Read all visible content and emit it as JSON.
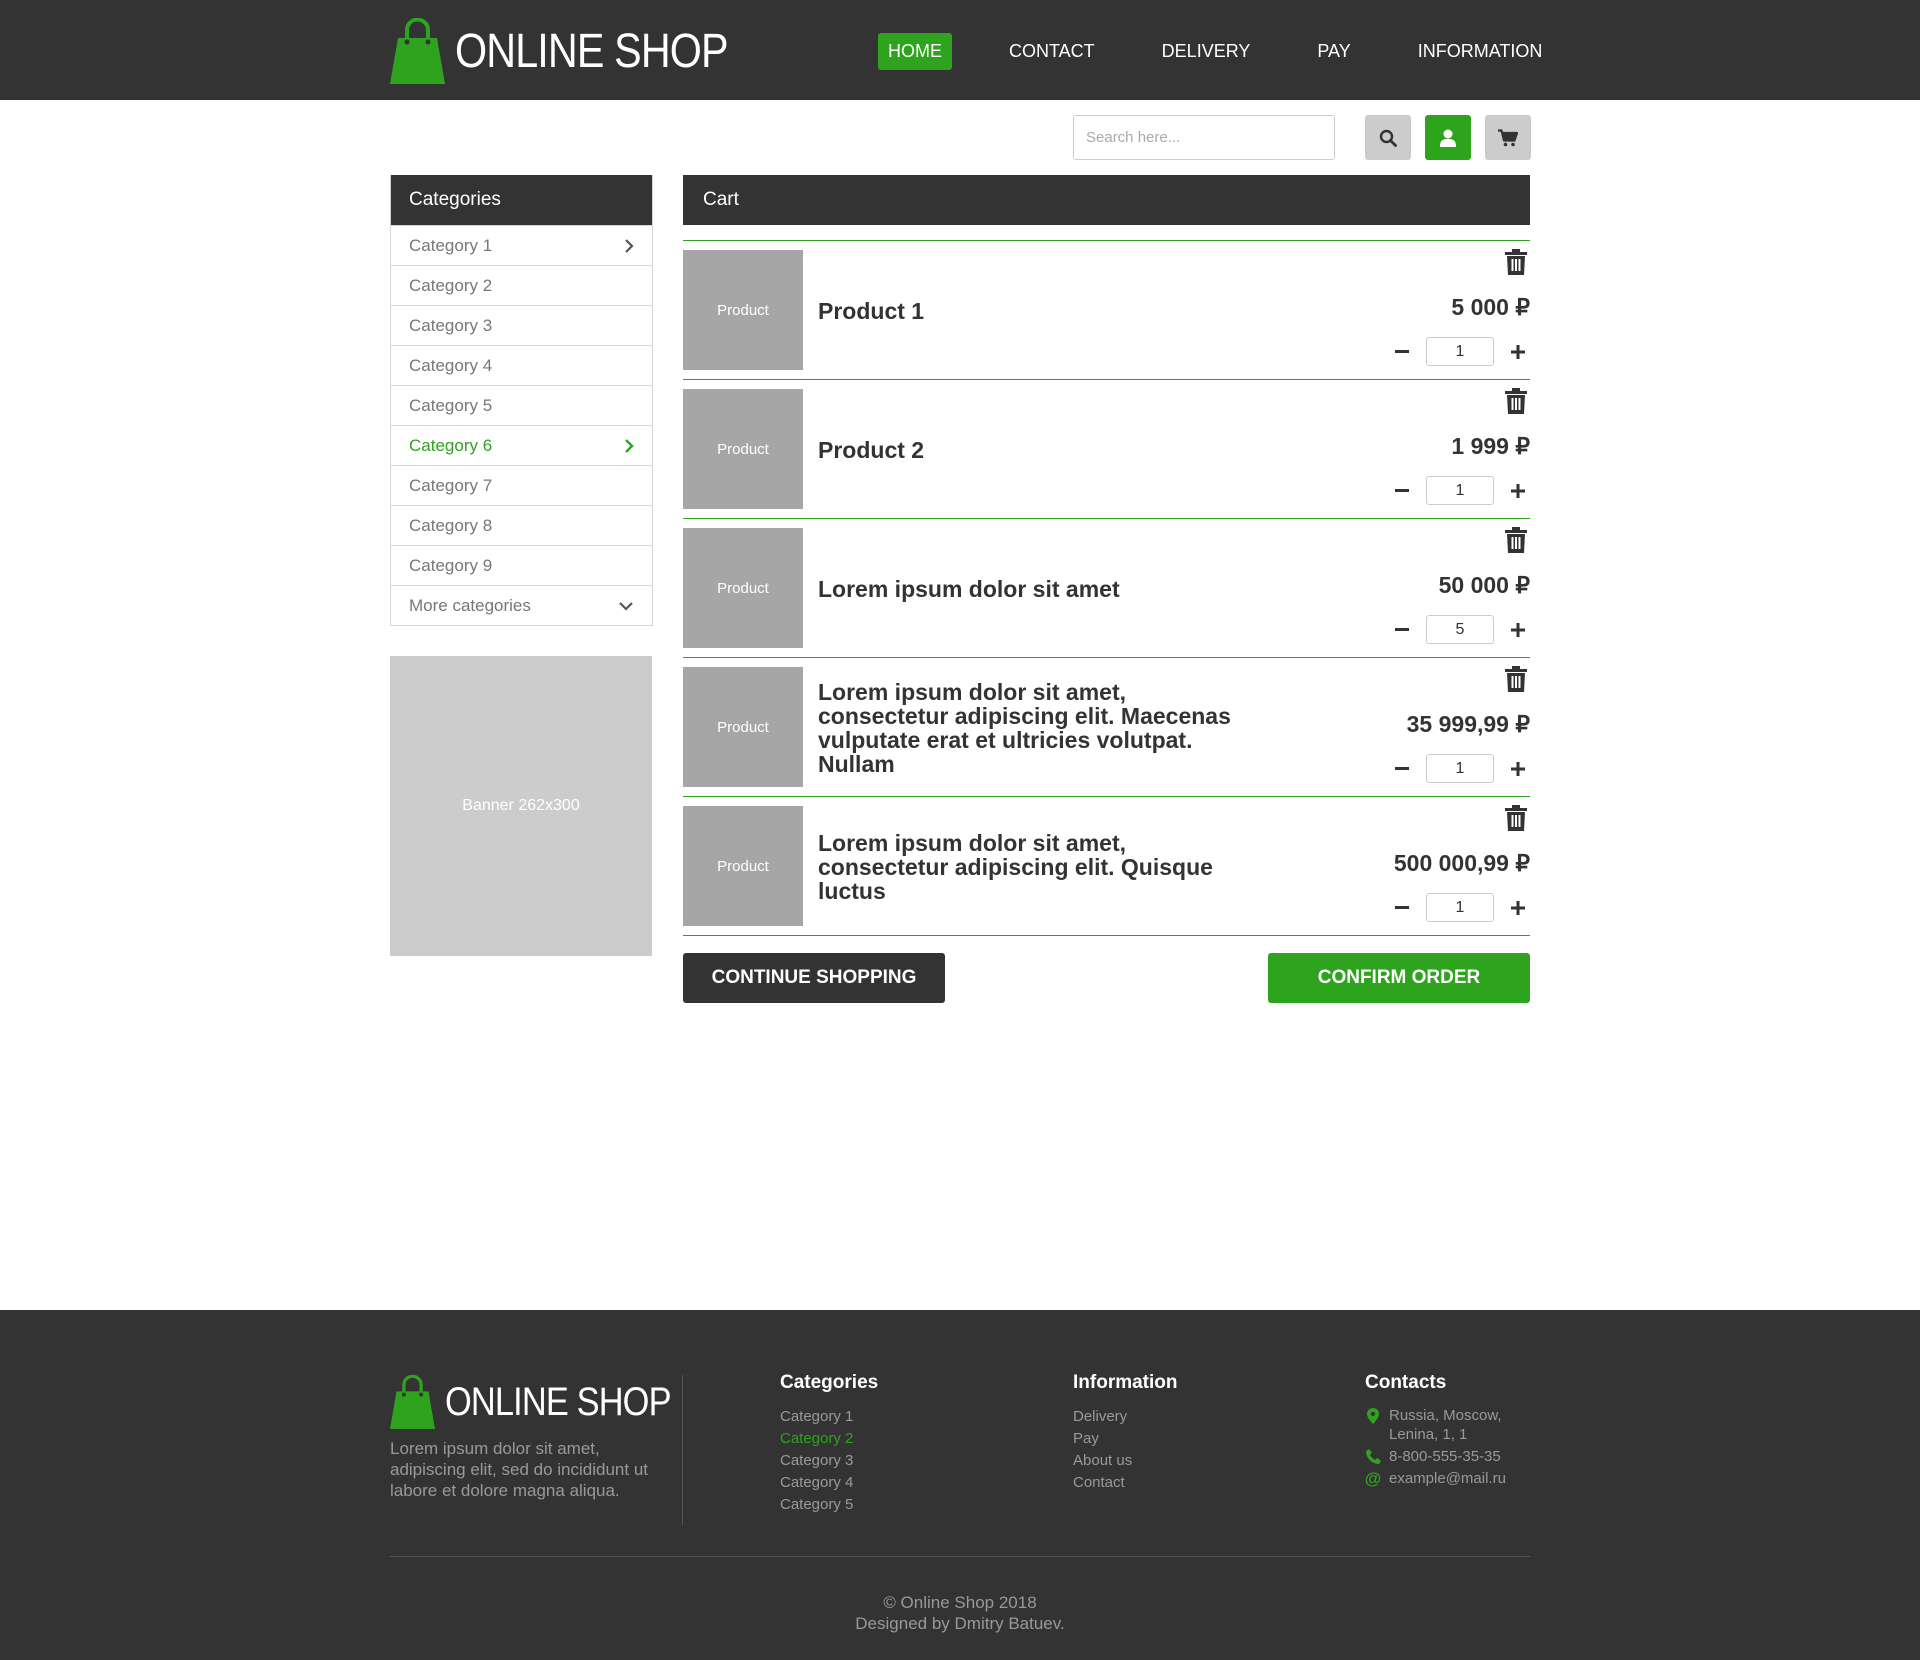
{
  "header": {
    "logo_text": "ONLINE SHOP",
    "nav": [
      "HOME",
      "CONTACT",
      "DELIVERY",
      "PAY",
      "INFORMATION"
    ]
  },
  "search": {
    "placeholder": "Search here..."
  },
  "icons": {
    "search": "search-icon",
    "user": "user-icon",
    "cart": "cart-icon",
    "trash": "trash-icon",
    "chevron_right": "chevron-right-icon",
    "chevron_down": "chevron-down-icon",
    "map_marker": "map-marker-icon",
    "phone": "phone-icon",
    "at": "at-icon"
  },
  "colors": {
    "accent": "#2ea31e",
    "dark": "#333333",
    "placeholder_gray": "#cccccc"
  },
  "sidebar": {
    "title": "Categories",
    "items": [
      "Category 1",
      "Category 2",
      "Category 3",
      "Category 4",
      "Category 5",
      "Category 6",
      "Category 7",
      "Category 8",
      "Category 9"
    ],
    "more": "More categories",
    "banner": "Banner 262x300"
  },
  "cart": {
    "title": "Cart",
    "items": [
      {
        "thumb": "Product",
        "name": "Product 1",
        "price": "5 000 ₽",
        "qty": "1"
      },
      {
        "thumb": "Product",
        "name": "Product 2",
        "price": "1 999 ₽",
        "qty": "1"
      },
      {
        "thumb": "Product",
        "name": "Lorem ipsum dolor sit amet",
        "price": "50 000 ₽",
        "qty": "5"
      },
      {
        "thumb": "Product",
        "name": "Lorem ipsum dolor sit amet, consectetur adipiscing elit. Maecenas vulputate erat et ultricies volutpat. Nullam",
        "price": "35 999,99 ₽",
        "qty": "1"
      },
      {
        "thumb": "Product",
        "name": "Lorem ipsum dolor sit amet, consectetur adipiscing elit. Quisque luctus",
        "price": "500 000,99 ₽",
        "qty": "1"
      }
    ],
    "continue_label": "CONTINUE SHOPPING",
    "confirm_label": "CONFIRM ORDER"
  },
  "footer": {
    "logo_text": "ONLINE SHOP",
    "description": "Lorem ipsum dolor sit amet, adipiscing elit, sed do incididunt ut labore et dolore magna aliqua.",
    "categories_title": "Categories",
    "categories": [
      "Category 1",
      "Category 2",
      "Category 3",
      "Category 4",
      "Category 5"
    ],
    "information_title": "Information",
    "information": [
      "Delivery",
      "Pay",
      "About us",
      "Contact"
    ],
    "contacts_title": "Contacts",
    "address_line1": "Russia, Moscow,",
    "address_line2": "Lenina, 1, 1",
    "phone": "8-800-555-35-35",
    "email": "example@mail.ru",
    "copyright": "© Online Shop 2018",
    "designed_by": "Designed by Dmitry Batuev."
  }
}
